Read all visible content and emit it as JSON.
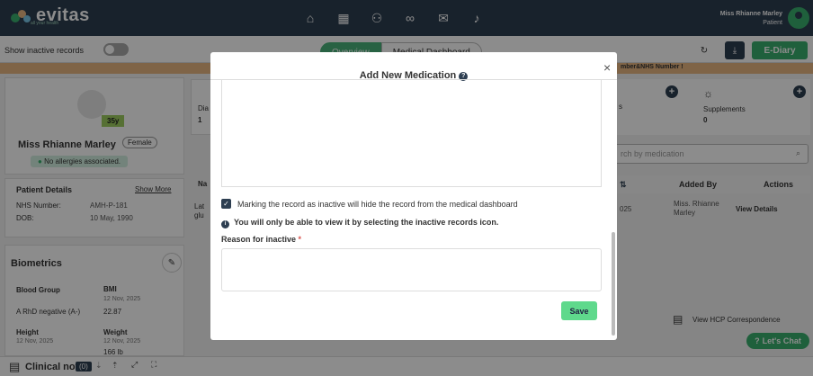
{
  "app": {
    "logo_text": "evitas",
    "logo_tagline": "all your health"
  },
  "user": {
    "name": "Miss Rhianne Marley",
    "role": "Patient"
  },
  "nav_icons": [
    "home-icon",
    "calendar-icon",
    "users-icon",
    "link-icon",
    "mail-icon",
    "bell-icon"
  ],
  "toolbar": {
    "inactive_label": "Show inactive records",
    "tab_overview": "Overview",
    "tab_dashboard": "Medical Dashboard",
    "ediary": "E-Diary"
  },
  "warning": {
    "text": "mber&NHS Number !"
  },
  "patient": {
    "age": "35y",
    "name": "Miss Rhianne Marley",
    "gender": "Female",
    "allergy": "No allergies associated.",
    "details_heading": "Patient Details",
    "show_more": "Show More",
    "nhs_label": "NHS Number:",
    "nhs_value": "AMH-P-181",
    "dob_label": "DOB:",
    "dob_value": "10 May, 1990"
  },
  "biometrics": {
    "heading": "Biometrics",
    "blood_group_label": "Blood Group",
    "blood_group_value": "A RhD negative (A-)",
    "bmi_label": "BMI",
    "bmi_date": "12 Nov, 2025",
    "bmi_value": "22.87",
    "height_label": "Height",
    "height_date": "12 Nov, 2025",
    "weight_label": "Weight",
    "weight_date": "12 Nov, 2025",
    "weight_value": "166 lb"
  },
  "side_cards": {
    "left_partial": "Dia",
    "left_value": "1",
    "mid_partial": "s",
    "supplements_label": "Supplements",
    "supplements_value": "0"
  },
  "search": {
    "placeholder": "rch by medication"
  },
  "table": {
    "col_name_partial": "Na",
    "col_added_by": "Added By",
    "col_actions": "Actions",
    "row_name_partial": "Lat",
    "row_name_partial2": "glu",
    "row_date_partial": "025",
    "row_added_by": "Miss. Rhianne Marley",
    "row_action": "View Details"
  },
  "hcp": {
    "label": "View HCP Correspondence"
  },
  "chat": {
    "label": "Let's Chat"
  },
  "bottom": {
    "clinical_label": "Clinical note",
    "count": "(0)"
  },
  "modal": {
    "title": "Add New Medication",
    "checkbox_text": "Marking the record as inactive will hide the record from the medical dashboard",
    "info_text": "You will only be able to view it by selecting the inactive records icon.",
    "reason_label": "Reason for inactive",
    "required_mark": "*",
    "save_label": "Save"
  }
}
